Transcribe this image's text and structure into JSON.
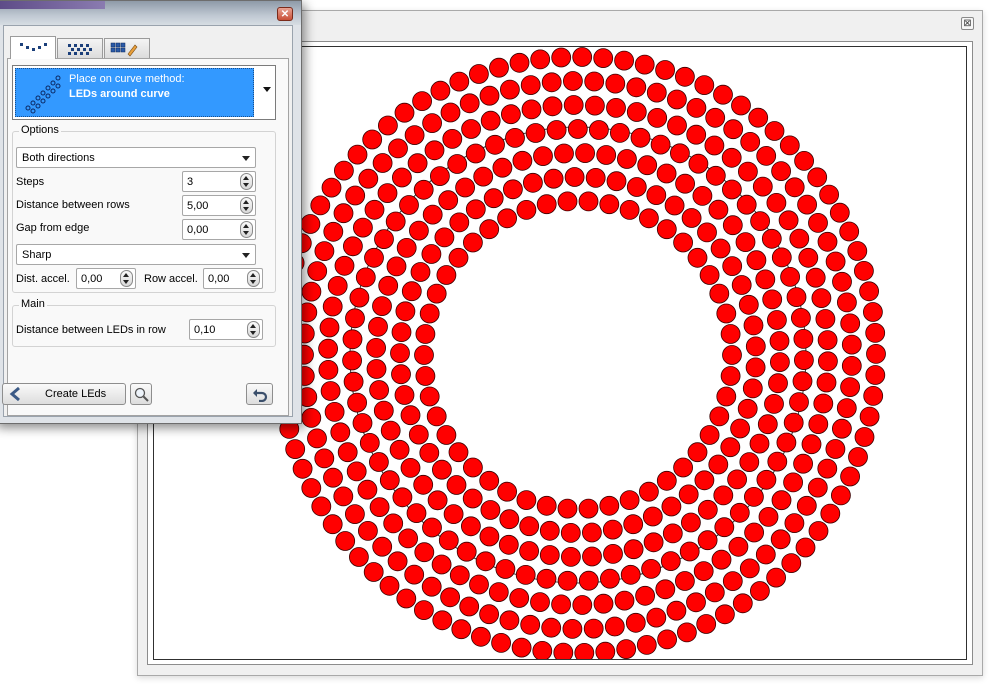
{
  "canvas_window": {
    "close_label": "⊠",
    "led_color": "#ff0000",
    "led_outline": "#3a0000"
  },
  "tool_window": {
    "close_label": "✕",
    "tabs": [
      {
        "icon": "led-row-dots-icon"
      },
      {
        "icon": "led-grid-pattern-icon"
      },
      {
        "icon": "grid-edit-icon"
      }
    ],
    "method": {
      "caption": "Place on curve method:",
      "value": "LEDs around curve",
      "icon": "diagonal-leds-icon",
      "highlight_color": "#3399ff"
    },
    "options": {
      "title": "Options",
      "direction": "Both directions",
      "steps_label": "Steps",
      "steps_value": "3",
      "distance_rows_label": "Distance between rows",
      "distance_rows_value": "5,00",
      "gap_label": "Gap from edge",
      "gap_value": "0,00",
      "corner_mode": "Sharp",
      "dist_accel_label": "Dist. accel.",
      "dist_accel_value": "0,00",
      "row_accel_label": "Row accel.",
      "row_accel_value": "0,00"
    },
    "main": {
      "title": "Main",
      "distance_leds_label": "Distance between LEDs in row",
      "distance_leds_value": "0,10"
    },
    "footer": {
      "create_label": "Create LEds",
      "back_icon": "back-arrow-icon",
      "preview_icon": "magnifier-icon",
      "undo_icon": "undo-icon"
    }
  }
}
